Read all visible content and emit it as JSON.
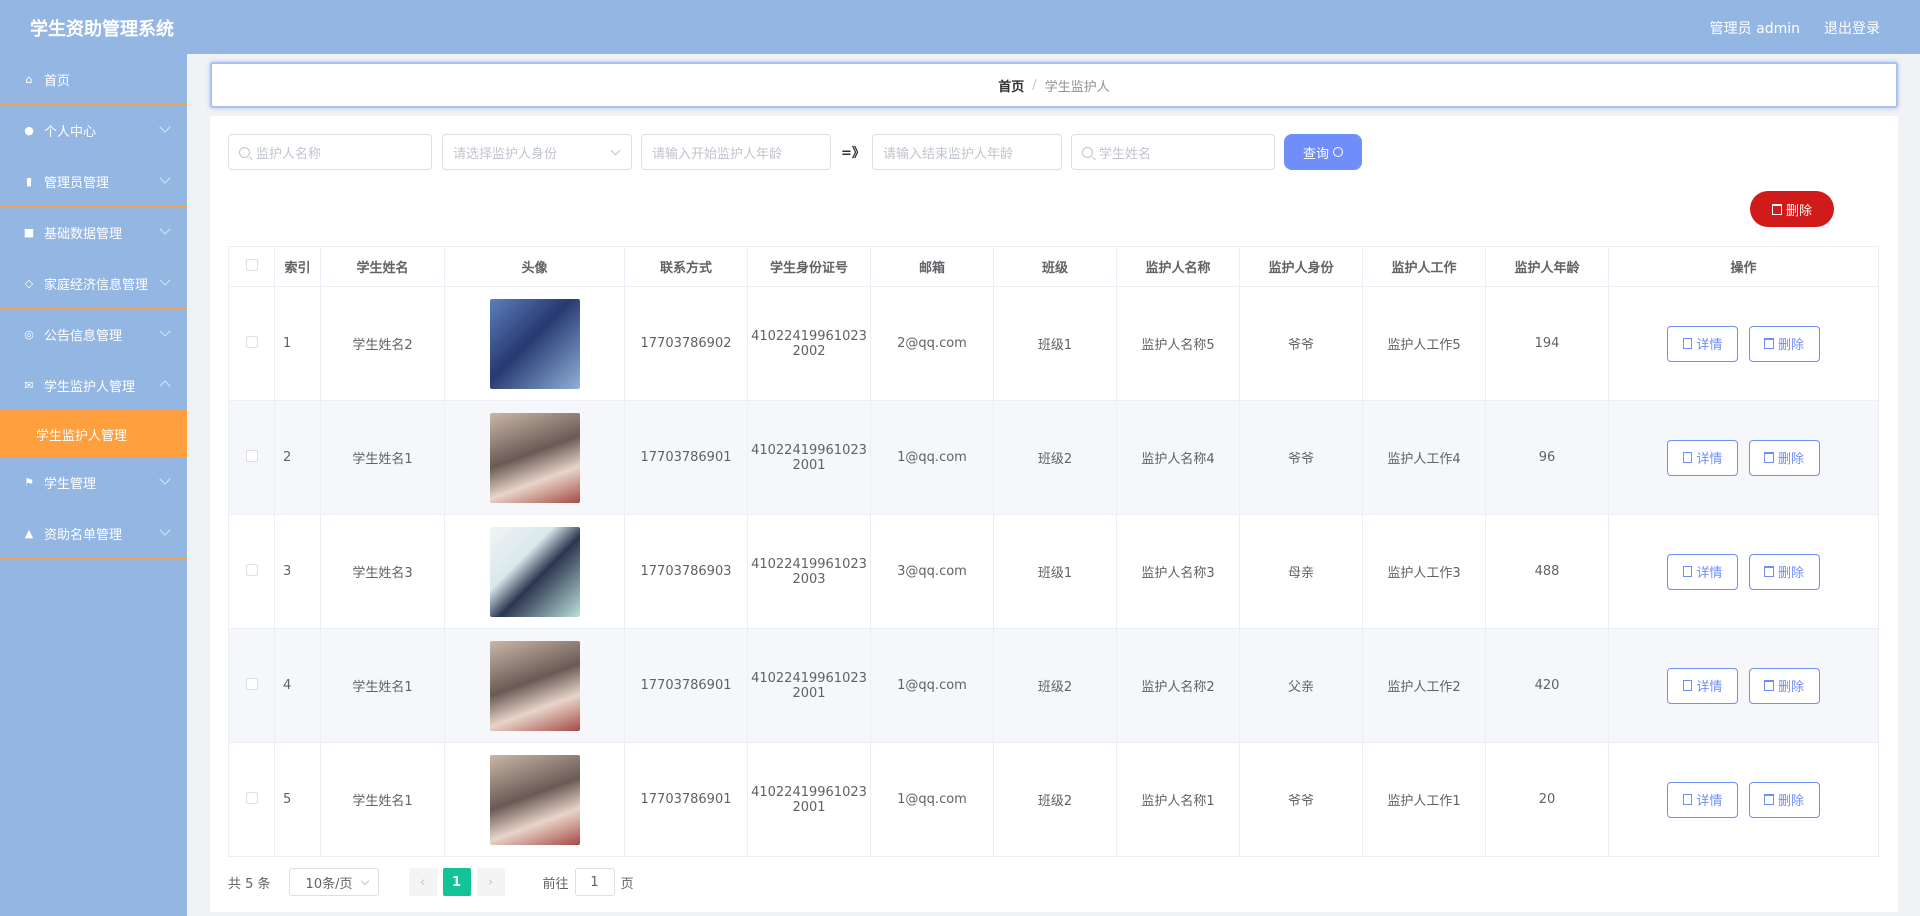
{
  "app": {
    "title": "学生资助管理系统"
  },
  "header": {
    "user": "管理员 admin",
    "logout": "退出登录"
  },
  "colors": {
    "topbar": "#94b6e3",
    "active_menu": "#ff9f3d",
    "primary": "#6f8ef9",
    "danger": "#d11b1b",
    "page_active": "#13c296"
  },
  "sidebar": {
    "items": [
      {
        "label": "首页",
        "icon": "home-icon"
      },
      {
        "label": "个人中心",
        "icon": "user-icon"
      },
      {
        "label": "管理员管理",
        "icon": "bar-chart-icon"
      },
      {
        "label": "基础数据管理",
        "icon": "briefcase-icon"
      },
      {
        "label": "家庭经济信息管理",
        "icon": "bell-icon"
      },
      {
        "label": "公告信息管理",
        "icon": "compass-icon"
      },
      {
        "label": "学生监护人管理",
        "icon": "envelope-icon"
      },
      {
        "label": "学生管理",
        "icon": "flag-icon"
      },
      {
        "label": "资助名单管理",
        "icon": "thumbs-up-icon"
      }
    ],
    "active_sub": "学生监护人管理"
  },
  "breadcrumb": {
    "home": "首页",
    "sep": "/",
    "current": "学生监护人"
  },
  "search": {
    "guardian_name_placeholder": "监护人名称",
    "guardian_identity_placeholder": "请选择监护人身份",
    "age_start_placeholder": "请输入开始监护人年龄",
    "age_op": "=》",
    "age_end_placeholder": "请输入结束监护人年龄",
    "student_name_placeholder": "学生姓名",
    "query_label": "查询"
  },
  "actions": {
    "delete_label": "删除"
  },
  "table": {
    "headers": [
      "索引",
      "学生姓名",
      "头像",
      "联系方式",
      "学生身份证号",
      "邮箱",
      "班级",
      "监护人名称",
      "监护人身份",
      "监护人工作",
      "监护人年龄",
      "操作"
    ],
    "detail_label": "详情",
    "delete_label": "删除",
    "rows": [
      {
        "index": "1",
        "student": "学生姓名2",
        "phone": "17703786902",
        "id_line1": "41022419961023",
        "id_line2": "2002",
        "email": "2@qq.com",
        "class": "班级1",
        "guardian": "监护人名称5",
        "identity": "爷爷",
        "job": "监护人工作5",
        "age": "194"
      },
      {
        "index": "2",
        "student": "学生姓名1",
        "phone": "17703786901",
        "id_line1": "41022419961023",
        "id_line2": "2001",
        "email": "1@qq.com",
        "class": "班级2",
        "guardian": "监护人名称4",
        "identity": "爷爷",
        "job": "监护人工作4",
        "age": "96"
      },
      {
        "index": "3",
        "student": "学生姓名3",
        "phone": "17703786903",
        "id_line1": "41022419961023",
        "id_line2": "2003",
        "email": "3@qq.com",
        "class": "班级1",
        "guardian": "监护人名称3",
        "identity": "母亲",
        "job": "监护人工作3",
        "age": "488"
      },
      {
        "index": "4",
        "student": "学生姓名1",
        "phone": "17703786901",
        "id_line1": "41022419961023",
        "id_line2": "2001",
        "email": "1@qq.com",
        "class": "班级2",
        "guardian": "监护人名称2",
        "identity": "父亲",
        "job": "监护人工作2",
        "age": "420"
      },
      {
        "index": "5",
        "student": "学生姓名1",
        "phone": "17703786901",
        "id_line1": "41022419961023",
        "id_line2": "2001",
        "email": "1@qq.com",
        "class": "班级2",
        "guardian": "监护人名称1",
        "identity": "爷爷",
        "job": "监护人工作1",
        "age": "20"
      }
    ]
  },
  "pagination": {
    "total": "共 5 条",
    "page_size": "10条/页",
    "prev": "‹",
    "current_page": "1",
    "next": "›",
    "goto_prefix": "前往",
    "goto_value": "1",
    "goto_suffix": "页"
  }
}
